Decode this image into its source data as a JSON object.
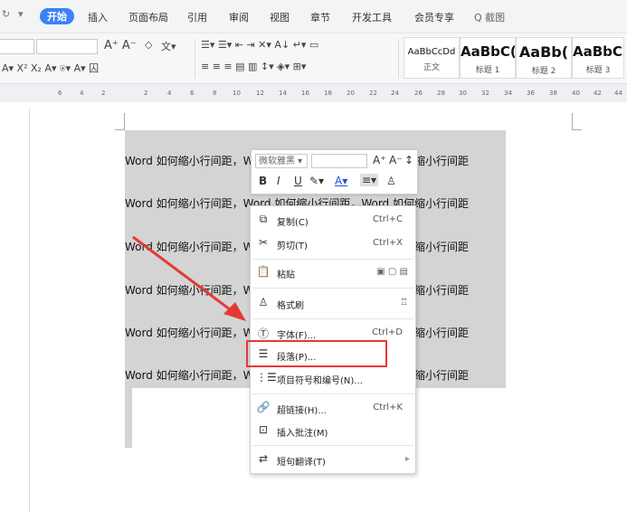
{
  "menubar": {
    "tabs": [
      "开始",
      "插入",
      "页面布局",
      "引用",
      "审阅",
      "视图",
      "章节",
      "开发工具",
      "会员专享"
    ],
    "active_tab": "开始",
    "search_label": "Q 截图"
  },
  "ribbon": {
    "styles": [
      {
        "sample": "AaBbCcDd",
        "name": "正文"
      },
      {
        "sample": "AaBbC(",
        "name": "标题 1"
      },
      {
        "sample": "AaBb(",
        "name": "标题 2"
      },
      {
        "sample": "AaBbC(",
        "name": "标题 3"
      }
    ]
  },
  "ruler": {
    "ticks": [
      "6",
      "4",
      "2",
      "2",
      "4",
      "6",
      "8",
      "10",
      "12",
      "14",
      "16",
      "18",
      "20",
      "22",
      "24",
      "26",
      "28",
      "30",
      "32",
      "34",
      "36",
      "38",
      "40",
      "42",
      "44"
    ]
  },
  "document": {
    "line_text": "Word 如何缩小行间距，Word 如何缩小行间距，Word 如何缩小行间距"
  },
  "mini_toolbar": {
    "font_name": "微软雅黑",
    "bold": "B",
    "italic": "I",
    "underline": "U"
  },
  "context_menu": {
    "items": [
      {
        "label": "复制(C)",
        "shortcut": "Ctrl+C",
        "icon": "copy-icon"
      },
      {
        "label": "剪切(T)",
        "shortcut": "Ctrl+X",
        "icon": "scissors-icon"
      },
      {
        "label": "粘贴",
        "shortcut": "",
        "icon": "paste-icon"
      },
      {
        "label": "格式刷",
        "shortcut": "",
        "icon": "format-painter-icon"
      },
      {
        "label": "字体(F)...",
        "shortcut": "Ctrl+D",
        "icon": "font-icon"
      },
      {
        "label": "段落(P)...",
        "shortcut": "",
        "icon": "paragraph-icon"
      },
      {
        "label": "项目符号和编号(N)...",
        "shortcut": "",
        "icon": "bullets-icon"
      },
      {
        "label": "超链接(H)...",
        "shortcut": "Ctrl+K",
        "icon": "link-icon"
      },
      {
        "label": "插入批注(M)",
        "shortcut": "",
        "icon": "comment-icon"
      },
      {
        "label": "短句翻译(T)",
        "shortcut": "",
        "icon": "translate-icon"
      }
    ]
  },
  "colors": {
    "accent": "#3b82f6",
    "highlight_box": "#e53935",
    "arrow": "#e53935",
    "selection": "#d4d4d4"
  }
}
